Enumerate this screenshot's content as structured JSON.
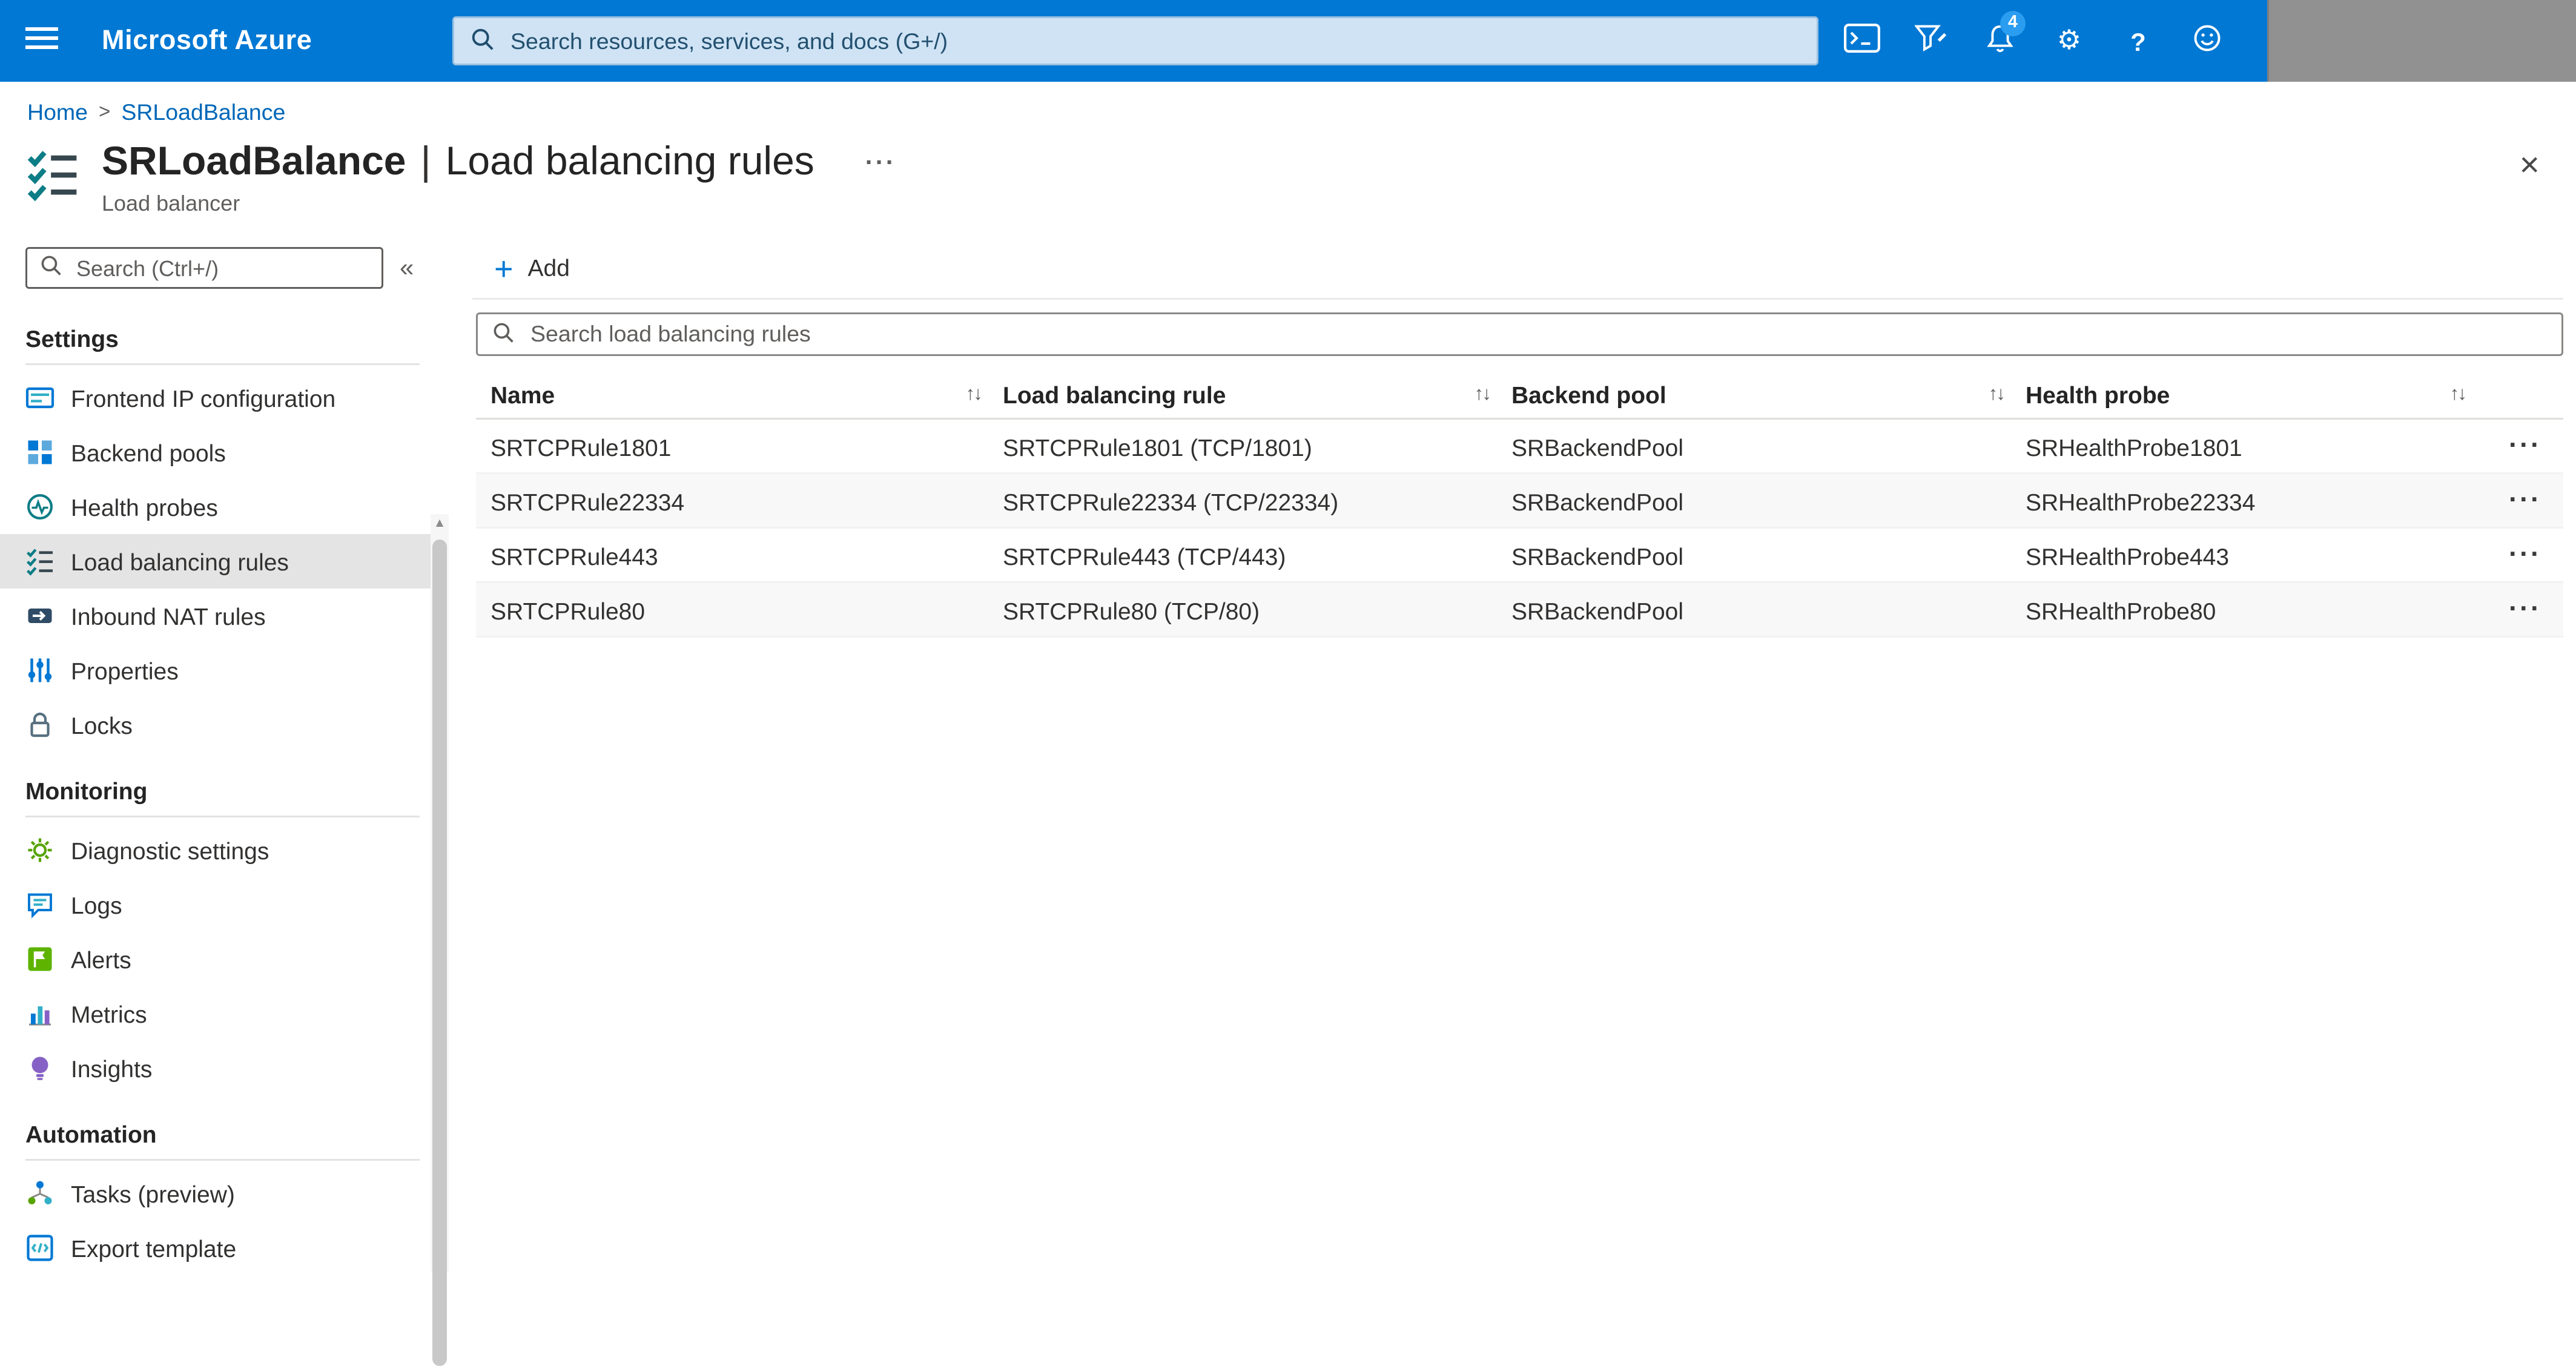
{
  "colors": {
    "azure_blue": "#0078d4",
    "link_blue": "#0067b8",
    "selected_item_bg": "#e4e4e4",
    "badge_blue": "#2b9df0",
    "account_block_gray": "#919191"
  },
  "header": {
    "brand": "Microsoft Azure",
    "search_placeholder": "Search resources, services, and docs (G+/)",
    "notification_badge": "4",
    "gear_glyph": "⚙",
    "help_glyph": "?"
  },
  "breadcrumb": {
    "home": "Home",
    "separator": ">",
    "current": "SRLoadBalance"
  },
  "page": {
    "resource_name": "SRLoadBalance",
    "title_separator": "|",
    "view_name": "Load balancing rules",
    "resource_type": "Load balancer",
    "more_glyph": "···",
    "close_glyph": "×"
  },
  "sidebar": {
    "search_placeholder": "Search (Ctrl+/)",
    "collapse_glyph": "«",
    "scroll_up_glyph": "▲",
    "sections": [
      {
        "title": "Settings",
        "items": [
          {
            "label": "Frontend IP configuration",
            "icon": "frontend-ip-icon",
            "selected": false
          },
          {
            "label": "Backend pools",
            "icon": "backend-pools-icon",
            "selected": false
          },
          {
            "label": "Health probes",
            "icon": "health-probes-icon",
            "selected": false
          },
          {
            "label": "Load balancing rules",
            "icon": "load-balancing-rules-icon",
            "selected": true
          },
          {
            "label": "Inbound NAT rules",
            "icon": "inbound-nat-rules-icon",
            "selected": false
          },
          {
            "label": "Properties",
            "icon": "properties-icon",
            "selected": false
          },
          {
            "label": "Locks",
            "icon": "locks-icon",
            "selected": false
          }
        ]
      },
      {
        "title": "Monitoring",
        "items": [
          {
            "label": "Diagnostic settings",
            "icon": "diagnostic-settings-icon",
            "selected": false
          },
          {
            "label": "Logs",
            "icon": "logs-icon",
            "selected": false
          },
          {
            "label": "Alerts",
            "icon": "alerts-icon",
            "selected": false
          },
          {
            "label": "Metrics",
            "icon": "metrics-icon",
            "selected": false
          },
          {
            "label": "Insights",
            "icon": "insights-icon",
            "selected": false
          }
        ]
      },
      {
        "title": "Automation",
        "items": [
          {
            "label": "Tasks (preview)",
            "icon": "tasks-icon",
            "selected": false
          },
          {
            "label": "Export template",
            "icon": "export-template-icon",
            "selected": false
          }
        ]
      }
    ]
  },
  "toolbar": {
    "add_glyph": "+",
    "add_label": "Add"
  },
  "rules": {
    "search_placeholder": "Search load balancing rules",
    "sort_glyph": "↑↓",
    "row_menu_glyph": "···",
    "columns": [
      "Name",
      "Load balancing rule",
      "Backend pool",
      "Health probe"
    ],
    "rows": [
      {
        "name": "SRTCPRule1801",
        "rule": "SRTCPRule1801 (TCP/1801)",
        "backend_pool": "SRBackendPool",
        "health_probe": "SRHealthProbe1801"
      },
      {
        "name": "SRTCPRule22334",
        "rule": "SRTCPRule22334 (TCP/22334)",
        "backend_pool": "SRBackendPool",
        "health_probe": "SRHealthProbe22334"
      },
      {
        "name": "SRTCPRule443",
        "rule": "SRTCPRule443 (TCP/443)",
        "backend_pool": "SRBackendPool",
        "health_probe": "SRHealthProbe443"
      },
      {
        "name": "SRTCPRule80",
        "rule": "SRTCPRule80 (TCP/80)",
        "backend_pool": "SRBackendPool",
        "health_probe": "SRHealthProbe80"
      }
    ]
  }
}
